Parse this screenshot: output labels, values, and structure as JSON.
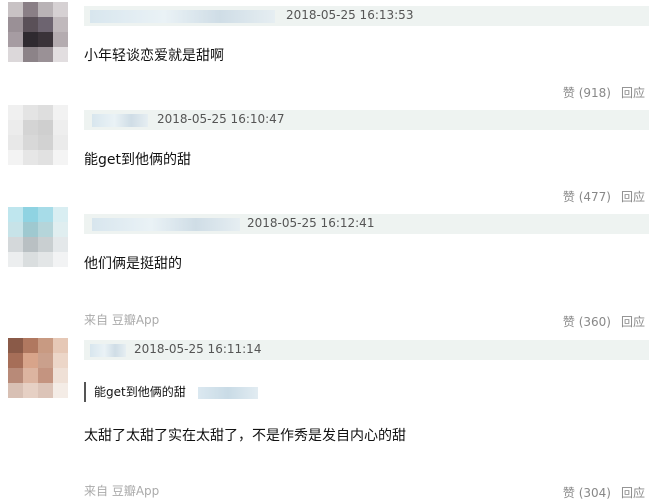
{
  "comments": [
    {
      "time": "2018-05-25 16:13:53",
      "text": "小年轻谈恋爱就是甜啊",
      "like_label": "赞 (918)",
      "reply_label": "回应"
    },
    {
      "time": "2018-05-25 16:10:47",
      "text": "能get到他俩的甜",
      "like_label": "赞 (477)",
      "reply_label": "回应"
    },
    {
      "time": "2018-05-25 16:12:41",
      "text": "他们俩是挺甜的",
      "source": "来自 豆瓣App",
      "like_label": "赞 (360)",
      "reply_label": "回应"
    },
    {
      "time": "2018-05-25 16:11:14",
      "quote": "能get到他俩的甜",
      "text": "太甜了太甜了实在太甜了，不是作秀是发自内心的甜",
      "source": "来自 豆瓣App",
      "like_label": "赞 (304)",
      "reply_label": "回应"
    }
  ],
  "colors": {
    "header_bg": "#eef3f1",
    "action_text": "#888888",
    "source_text": "#aaaaaa"
  }
}
